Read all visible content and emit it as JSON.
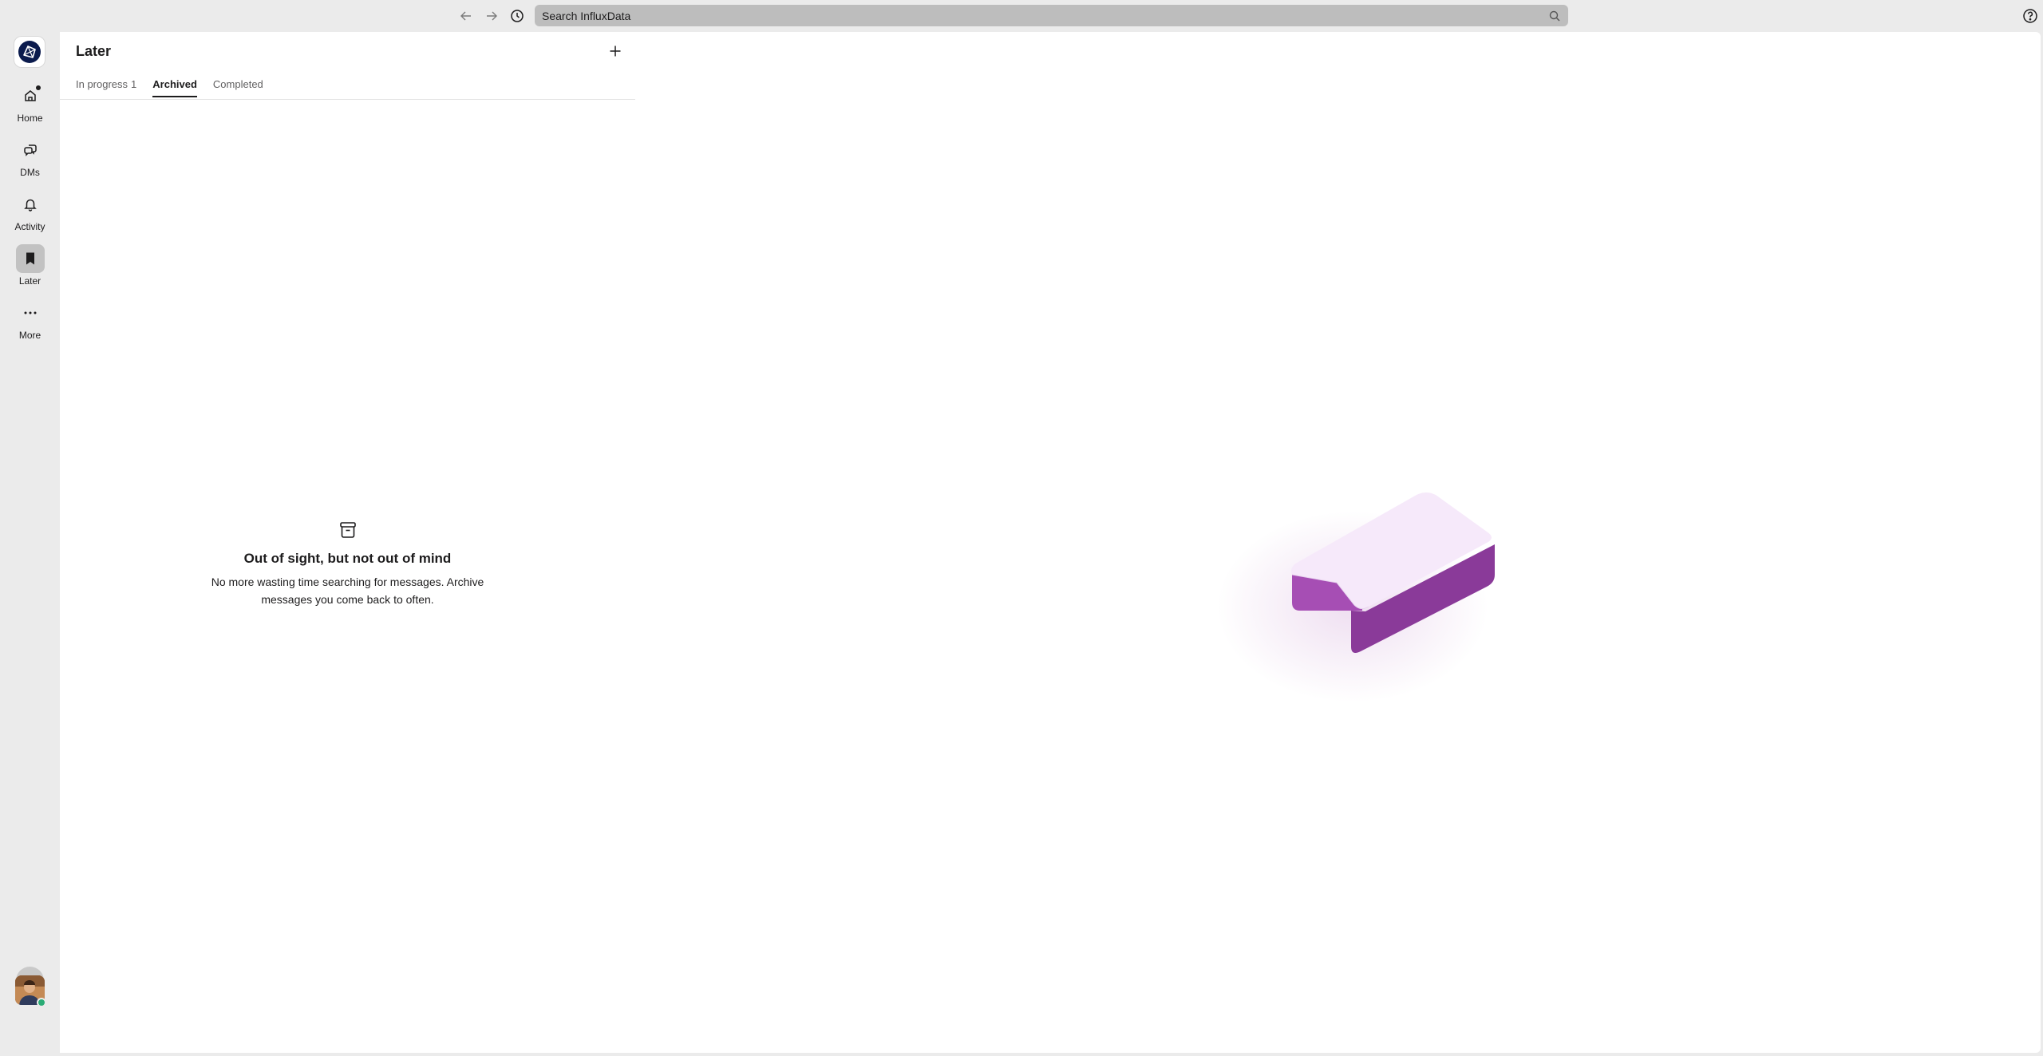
{
  "topbar": {
    "search_placeholder": "Search InfluxData"
  },
  "rail": {
    "items": [
      {
        "label": "Home",
        "icon": "home-icon"
      },
      {
        "label": "DMs",
        "icon": "dms-icon"
      },
      {
        "label": "Activity",
        "icon": "bell-icon"
      },
      {
        "label": "Later",
        "icon": "bookmark-icon",
        "active": true
      },
      {
        "label": "More",
        "icon": "ellipsis-icon"
      }
    ]
  },
  "later": {
    "title": "Later",
    "tabs": [
      {
        "label": "In progress",
        "count": "1"
      },
      {
        "label": "Archived",
        "active": true
      },
      {
        "label": "Completed"
      }
    ],
    "empty": {
      "title": "Out of sight, but not out of mind",
      "description": "No more wasting time searching for messages. Archive messages you come back to often."
    }
  },
  "colors": {
    "background": "#ebebeb",
    "panel": "#ffffff",
    "accent_purple": "#a44ab0",
    "presence_green": "#2bac76"
  }
}
